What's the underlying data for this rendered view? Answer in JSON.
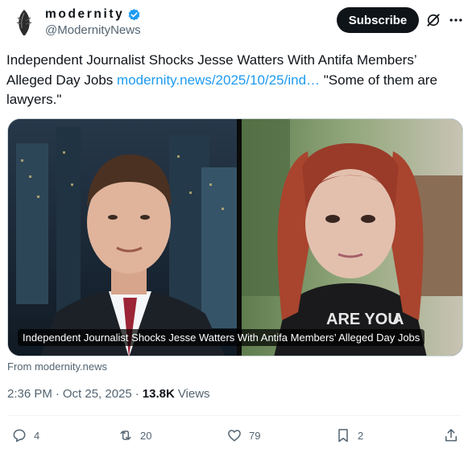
{
  "author": {
    "display_name": "modernity",
    "handle": "@ModernityNews",
    "verified": true,
    "avatar_icon": "feather-logo-icon"
  },
  "header": {
    "subscribe_label": "Subscribe",
    "grok_icon": "grok-icon",
    "more_icon": "more-icon"
  },
  "tweet": {
    "text_before_link": "Independent Journalist Shocks Jesse Watters With Antifa Members’ Alleged Day Jobs ",
    "link_text": "modernity.news/2025/10/25/ind…",
    "text_after_link": " \"Some of them are lawyers.\""
  },
  "media": {
    "caption": "Independent Journalist Shocks Jesse Watters With Antifa Members’ Alleged Day Jobs",
    "shirt_text_line1": "ARE YOU",
    "shirt_text_line2": "A"
  },
  "source": "From modernity.news",
  "meta": {
    "time": "2:36 PM",
    "date": "Oct 25, 2025",
    "views_count": "13.8K",
    "views_label": "Views",
    "separator": "·"
  },
  "actions": {
    "replies": "4",
    "reposts": "20",
    "likes": "79",
    "bookmarks": "2"
  },
  "colors": {
    "accent": "#1d9bf0",
    "text": "#0f1419",
    "muted": "#536471"
  }
}
